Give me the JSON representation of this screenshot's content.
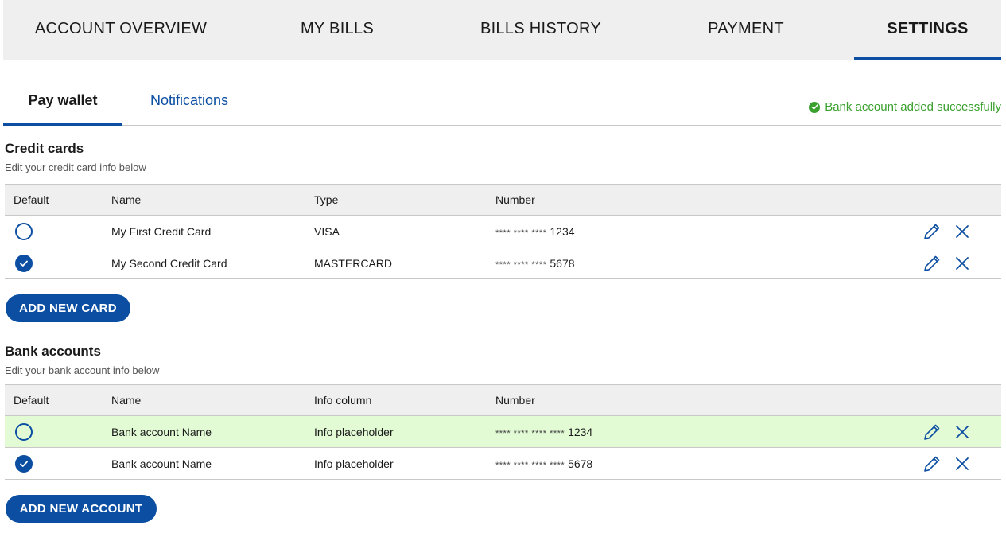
{
  "topnav": {
    "tabs": [
      {
        "label": "ACCOUNT OVERVIEW"
      },
      {
        "label": "MY BILLS"
      },
      {
        "label": "BILLS HISTORY"
      },
      {
        "label": "PAYMENT"
      },
      {
        "label": "SETTINGS",
        "active": true
      }
    ]
  },
  "subtabs": {
    "pay_wallet": "Pay wallet",
    "notifications": "Notifications"
  },
  "toast": {
    "message": "Bank account added successfully",
    "icon": "check-circle-icon",
    "color": "#3aa02e"
  },
  "credit_cards": {
    "title": "Credit cards",
    "subtitle": "Edit your credit card info below",
    "headers": {
      "default": "Default",
      "name": "Name",
      "type": "Type",
      "number": "Number"
    },
    "rows": [
      {
        "default": false,
        "name": "My First Credit Card",
        "type": "VISA",
        "masked": "**** **** ****",
        "last4": "1234"
      },
      {
        "default": true,
        "name": "My Second Credit Card",
        "type": "MASTERCARD",
        "masked": "**** **** ****",
        "last4": "5678"
      }
    ],
    "add_button": "ADD NEW CARD"
  },
  "bank_accounts": {
    "title": "Bank accounts",
    "subtitle": "Edit your bank account info below",
    "headers": {
      "default": "Default",
      "name": "Name",
      "info": "Info column",
      "number": "Number"
    },
    "rows": [
      {
        "default": false,
        "name": "Bank account Name",
        "info": "Info placeholder",
        "masked": "**** **** **** ****",
        "last4": "1234",
        "highlight": true
      },
      {
        "default": true,
        "name": "Bank account Name",
        "info": "Info placeholder",
        "masked": "**** **** **** ****",
        "last4": "5678",
        "highlight": false
      }
    ],
    "add_button": "ADD NEW ACCOUNT"
  },
  "colors": {
    "accent": "#0b4ea2",
    "success": "#3aa02e",
    "highlight_row": "#e2fbd5"
  }
}
